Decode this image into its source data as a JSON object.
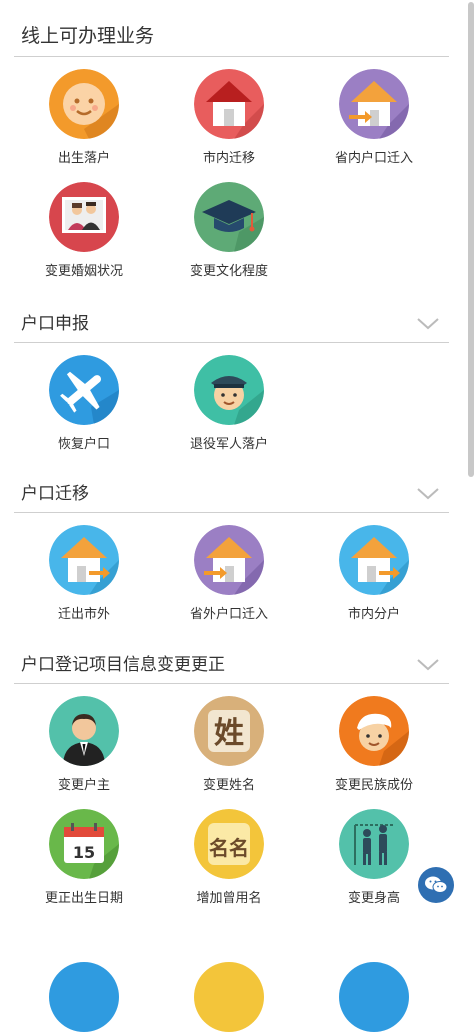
{
  "sections": [
    {
      "title": "线上可办理业务",
      "items": [
        {
          "label": "出生落户",
          "icon": "baby-face-icon"
        },
        {
          "label": "市内迁移",
          "icon": "red-house-icon"
        },
        {
          "label": "省内户口迁入",
          "icon": "house-arrow-in-icon"
        },
        {
          "label": "变更婚姻状况",
          "icon": "couple-photo-icon"
        },
        {
          "label": "变更文化程度",
          "icon": "graduation-cap-icon"
        }
      ]
    },
    {
      "title": "户口申报",
      "items": [
        {
          "label": "恢复户口",
          "icon": "airplane-icon"
        },
        {
          "label": "退役军人落户",
          "icon": "soldier-icon"
        }
      ]
    },
    {
      "title": "户口迁移",
      "items": [
        {
          "label": "迁出市外",
          "icon": "house-arrow-out-icon"
        },
        {
          "label": "省外户口迁入",
          "icon": "house-arrow-in-icon"
        },
        {
          "label": "市内分户",
          "icon": "house-arrow-out-icon"
        }
      ]
    },
    {
      "title": "户口登记项目信息变更更正",
      "items": [
        {
          "label": "变更户主",
          "icon": "businessman-icon"
        },
        {
          "label": "变更姓名",
          "icon": "surname-char-icon"
        },
        {
          "label": "变更民族成份",
          "icon": "ethnic-person-icon"
        },
        {
          "label": "更正出生日期",
          "icon": "calendar-icon"
        },
        {
          "label": "增加曾用名",
          "icon": "name-char-icon"
        },
        {
          "label": "变更身高",
          "icon": "height-people-icon"
        }
      ]
    }
  ],
  "calendar_day": "15",
  "surname_char": "姓",
  "name_chars": "名名",
  "colors": {
    "orange": "#f39a2b",
    "red": "#e85d5d",
    "purple": "#9b7fc4",
    "crimson": "#d7464d",
    "green": "#5eaa76",
    "blue": "#2f9be0",
    "teal": "#3fbfa5",
    "sky": "#48b6ea",
    "tan": "#d8b07a",
    "yellow": "#f3c53a",
    "lime": "#69b84a",
    "mint": "#53c1aa"
  }
}
